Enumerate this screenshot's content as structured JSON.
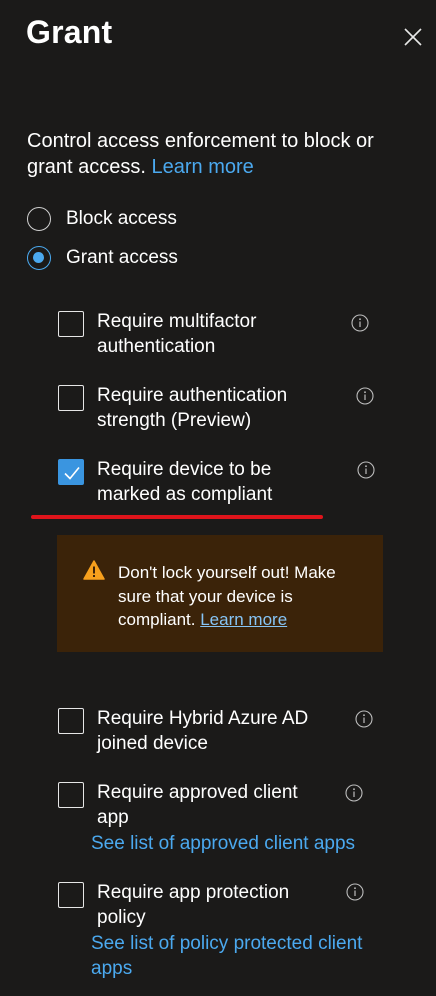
{
  "panel": {
    "title": "Grant"
  },
  "intro": {
    "text": "Control access enforcement to block or grant access.",
    "learn_more": "Learn more"
  },
  "access_options": [
    {
      "label": "Block access",
      "selected": false
    },
    {
      "label": "Grant access",
      "selected": true
    }
  ],
  "controls": [
    {
      "label": "Require multifactor authentication",
      "checked": false
    },
    {
      "label": "Require authentication strength (Preview)",
      "checked": false
    },
    {
      "label": "Require device to be marked as compliant",
      "checked": true
    },
    {
      "label": "Require Hybrid Azure AD joined device",
      "checked": false
    },
    {
      "label": "Require approved client app",
      "checked": false,
      "link": "See list of approved client apps"
    },
    {
      "label": "Require app protection policy",
      "checked": false,
      "link": "See list of policy protected client apps"
    }
  ],
  "warning": {
    "text": "Don't lock yourself out! Make sure that your device is compliant.",
    "link": "Learn more"
  },
  "colors": {
    "background": "#1b1a19",
    "accent": "#4ba9ef",
    "checkbox_checked": "#3a95e0",
    "warning_bg": "#3b2309",
    "warning_icon": "#f7a01d",
    "annotation_underline": "#e0141b"
  },
  "icons": {
    "close": "close-icon",
    "info": "info-icon",
    "warning": "warning-icon",
    "check": "checkmark-icon"
  }
}
